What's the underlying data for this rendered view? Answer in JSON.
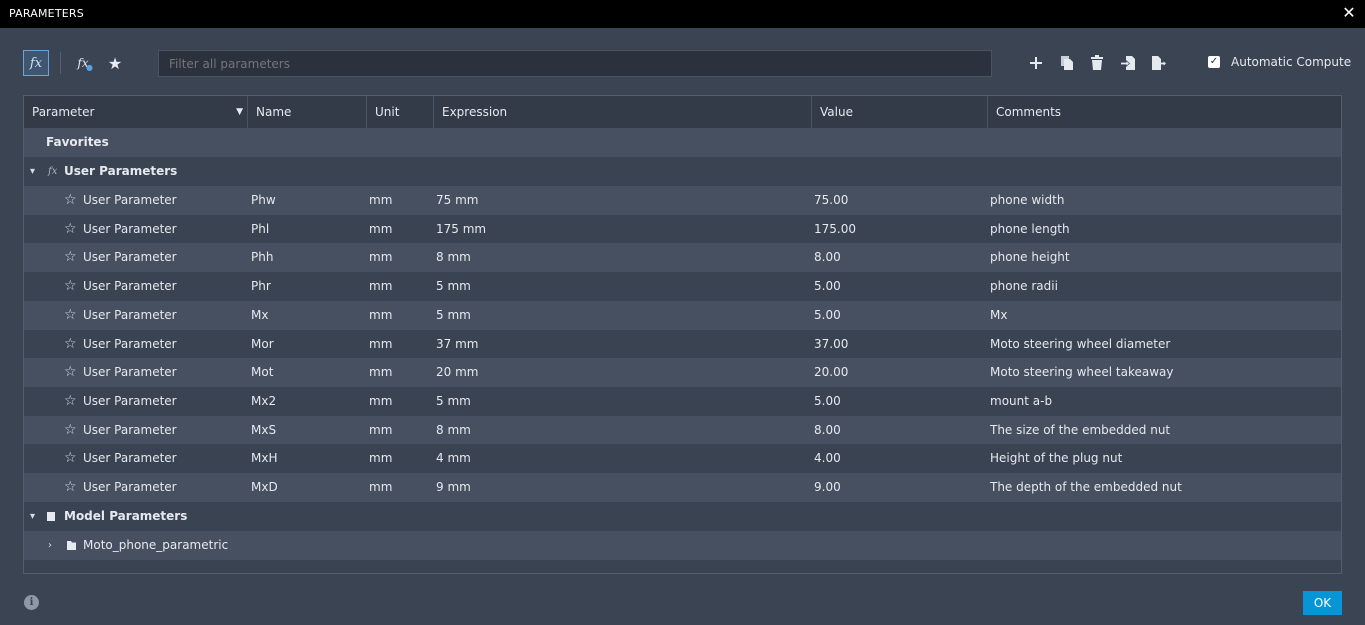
{
  "window": {
    "title": "PARAMETERS",
    "close_glyph": "✕"
  },
  "toolbar": {
    "fx_label": "fx",
    "filter_placeholder": "Filter all parameters",
    "actions": [
      "add-icon",
      "copy-icon",
      "delete-icon",
      "import-icon",
      "export-icon"
    ],
    "automatic_compute": {
      "label": "Automatic Compute",
      "checked": true
    }
  },
  "table": {
    "headers": {
      "parameter": "Parameter",
      "name": "Name",
      "unit": "Unit",
      "expression": "Expression",
      "value": "Value",
      "comments": "Comments"
    },
    "favorites_label": "Favorites",
    "user_group_label": "User Parameters",
    "rows": [
      {
        "parameter": "User Parameter",
        "name": "Phw",
        "unit": "mm",
        "expression": "75 mm",
        "value": "75.00",
        "comment": "phone width"
      },
      {
        "parameter": "User Parameter",
        "name": "Phl",
        "unit": "mm",
        "expression": "175 mm",
        "value": "175.00",
        "comment": "phone length"
      },
      {
        "parameter": "User Parameter",
        "name": "Phh",
        "unit": "mm",
        "expression": "8 mm",
        "value": "8.00",
        "comment": "phone height"
      },
      {
        "parameter": "User Parameter",
        "name": "Phr",
        "unit": "mm",
        "expression": "5 mm",
        "value": "5.00",
        "comment": "phone radii"
      },
      {
        "parameter": "User Parameter",
        "name": "Mx",
        "unit": "mm",
        "expression": "5 mm",
        "value": "5.00",
        "comment": "Mx"
      },
      {
        "parameter": "User Parameter",
        "name": "Mor",
        "unit": "mm",
        "expression": "37 mm",
        "value": "37.00",
        "comment": "Moto steering wheel diameter"
      },
      {
        "parameter": "User Parameter",
        "name": "Mot",
        "unit": "mm",
        "expression": "20 mm",
        "value": "20.00",
        "comment": "Moto steering wheel takeaway"
      },
      {
        "parameter": "User Parameter",
        "name": "Mx2",
        "unit": "mm",
        "expression": "5 mm",
        "value": "5.00",
        "comment": "mount a-b"
      },
      {
        "parameter": "User Parameter",
        "name": "MxS",
        "unit": "mm",
        "expression": "8 mm",
        "value": "8.00",
        "comment": "The size of the embedded nut"
      },
      {
        "parameter": "User Parameter",
        "name": "MxH",
        "unit": "mm",
        "expression": "4 mm",
        "value": "4.00",
        "comment": "Height of the plug nut"
      },
      {
        "parameter": "User Parameter",
        "name": "MxD",
        "unit": "mm",
        "expression": "9 mm",
        "value": "9.00",
        "comment": "The depth of the embedded nut"
      }
    ],
    "model_group_label": "Model Parameters",
    "model_item_label": "Moto_phone_parametric"
  },
  "footer": {
    "info_glyph": "i",
    "ok_label": "OK"
  },
  "colors": {
    "accent": "#0696d7",
    "background": "#3b4453",
    "row_alt": "#465060"
  }
}
